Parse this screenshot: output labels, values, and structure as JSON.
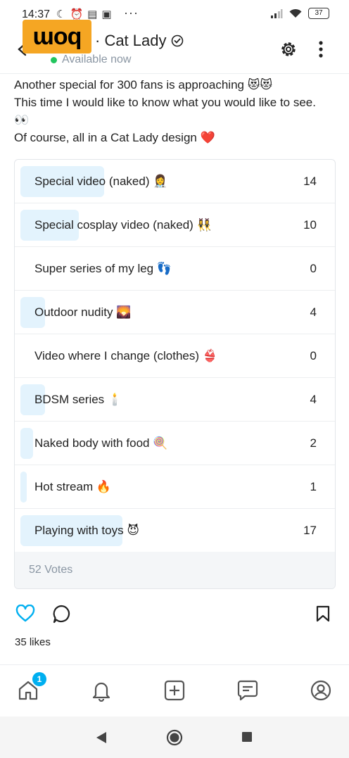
{
  "status_bar": {
    "time": "14:37",
    "battery": "37"
  },
  "header": {
    "logo_text": "ɯoq",
    "username": "· Cat Lady",
    "presence": "Available now"
  },
  "post": {
    "lines": [
      "Another special for 300 fans is approaching 😻😻",
      "This time I would like to know what you would like to see.",
      "👀",
      "Of course, all in a Cat Lady design ❤️"
    ]
  },
  "poll": {
    "options": [
      {
        "label": "Special video (naked) 👩‍⚕️",
        "count": "14",
        "share": 0.27
      },
      {
        "label": "Special cosplay video (naked) 👯‍♀️",
        "count": "10",
        "share": 0.19
      },
      {
        "label": "Super series of my leg 👣",
        "count": "0",
        "share": 0
      },
      {
        "label": "Outdoor nudity 🌄",
        "count": "4",
        "share": 0.08
      },
      {
        "label": "Video where I change (clothes) 👙",
        "count": "0",
        "share": 0
      },
      {
        "label": "BDSM series 🕯️",
        "count": "4",
        "share": 0.08
      },
      {
        "label": "Naked body with food 🍭",
        "count": "2",
        "share": 0.04
      },
      {
        "label": "Hot stream 🔥",
        "count": "1",
        "share": 0.02
      },
      {
        "label": "Playing with toys 😈",
        "count": "17",
        "share": 0.33
      }
    ],
    "votes_label": "52 Votes"
  },
  "actions": {
    "likes": "35 likes"
  },
  "bottom_nav": {
    "home_badge": "1"
  },
  "colors": {
    "accent": "#00aff0",
    "poll_fill": "#e3f3fd",
    "logo_bg": "#f5a623",
    "online": "#22c55e"
  },
  "icons": [
    "back-arrow-icon",
    "verified-icon",
    "gear-icon",
    "more-vertical-icon",
    "heart-icon",
    "comment-icon",
    "bookmark-icon",
    "home-icon",
    "bell-icon",
    "add-post-icon",
    "messages-icon",
    "profile-icon"
  ]
}
